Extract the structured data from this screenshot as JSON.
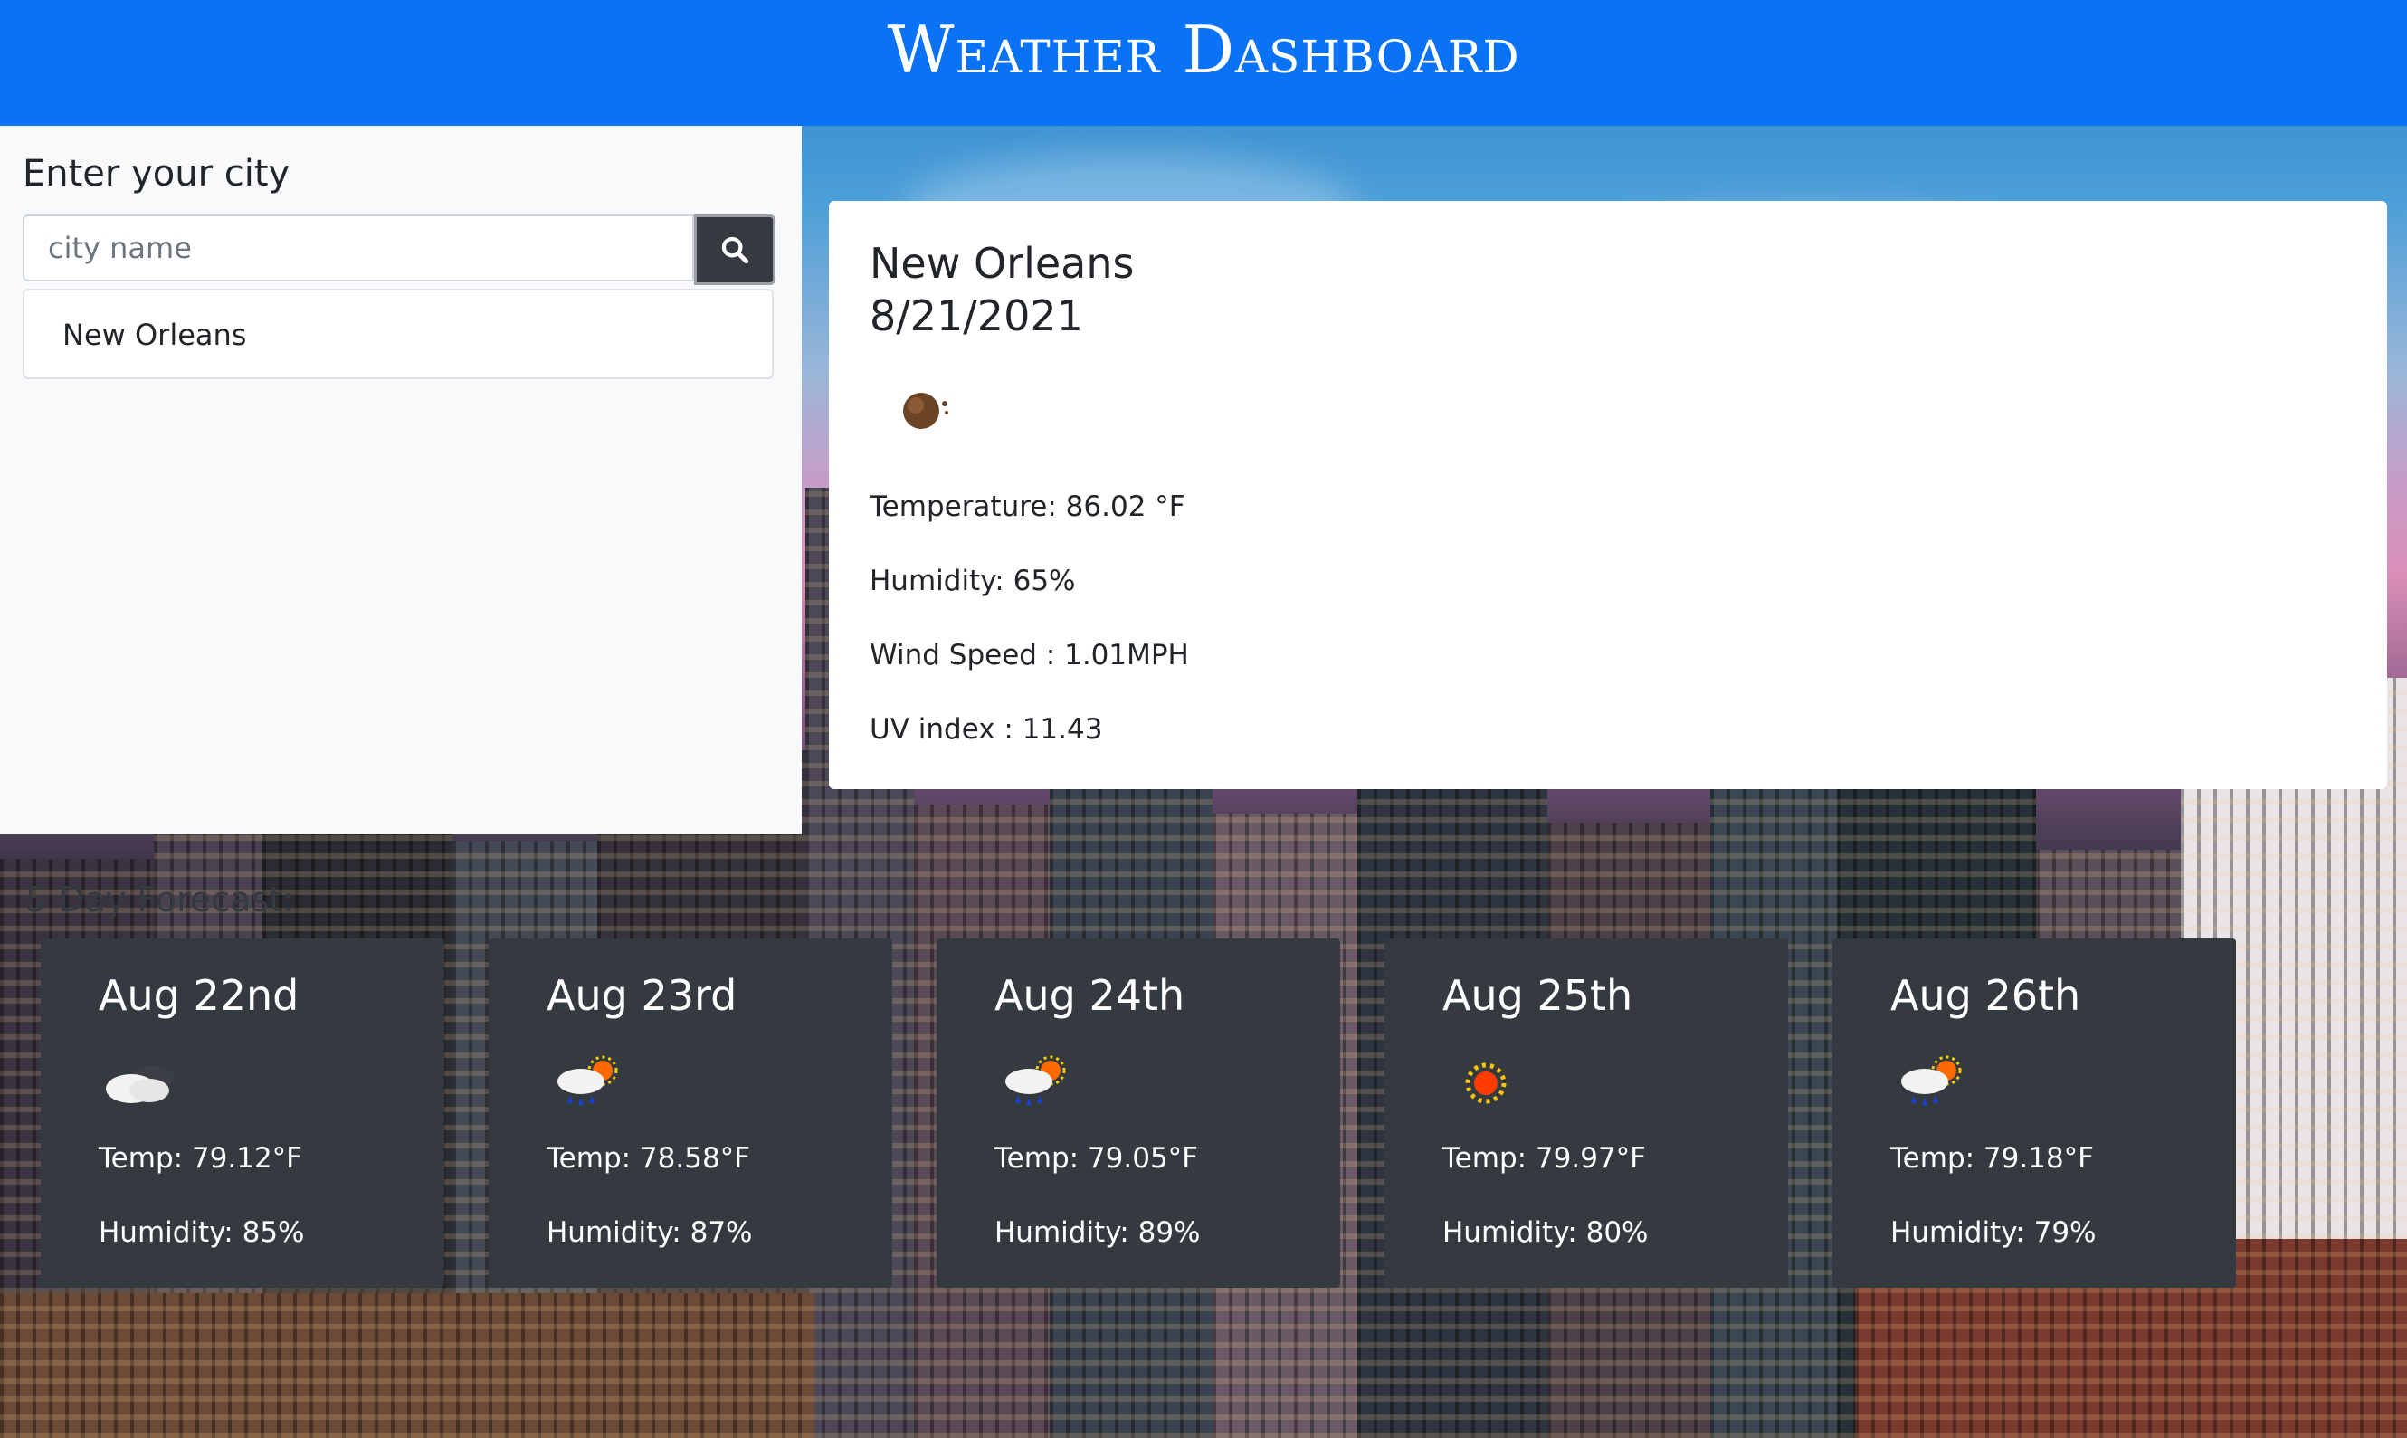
{
  "header": {
    "title": "Weather Dashboard"
  },
  "search": {
    "label": "Enter your city",
    "placeholder": "city name",
    "button_icon": "search-icon"
  },
  "history": [
    "New Orleans"
  ],
  "current": {
    "city": "New Orleans",
    "date": "8/21/2021",
    "icon": "moon-icon",
    "temperature": "Temperature: 86.02 °F",
    "humidity": "Humidity: 65%",
    "wind": "Wind Speed : 1.01MPH",
    "uv": "UV index : 11.43"
  },
  "forecast": {
    "title": "5 Day Forecast:",
    "days": [
      {
        "date": "Aug 22nd",
        "icon": "cloudy-icon",
        "temp": "Temp: 79.12°F",
        "humidity": "Humidity: 85%"
      },
      {
        "date": "Aug 23rd",
        "icon": "rain-sun-icon",
        "temp": "Temp: 78.58°F",
        "humidity": "Humidity: 87%"
      },
      {
        "date": "Aug 24th",
        "icon": "rain-sun-icon",
        "temp": "Temp: 79.05°F",
        "humidity": "Humidity: 89%"
      },
      {
        "date": "Aug 25th",
        "icon": "sun-icon",
        "temp": "Temp: 79.97°F",
        "humidity": "Humidity: 80%"
      },
      {
        "date": "Aug 26th",
        "icon": "rain-sun-icon",
        "temp": "Temp: 79.18°F",
        "humidity": "Humidity: 79%"
      }
    ]
  },
  "colors": {
    "header": "#0a73f5",
    "card_dark": "#343a40",
    "search_button": "#343a40"
  }
}
